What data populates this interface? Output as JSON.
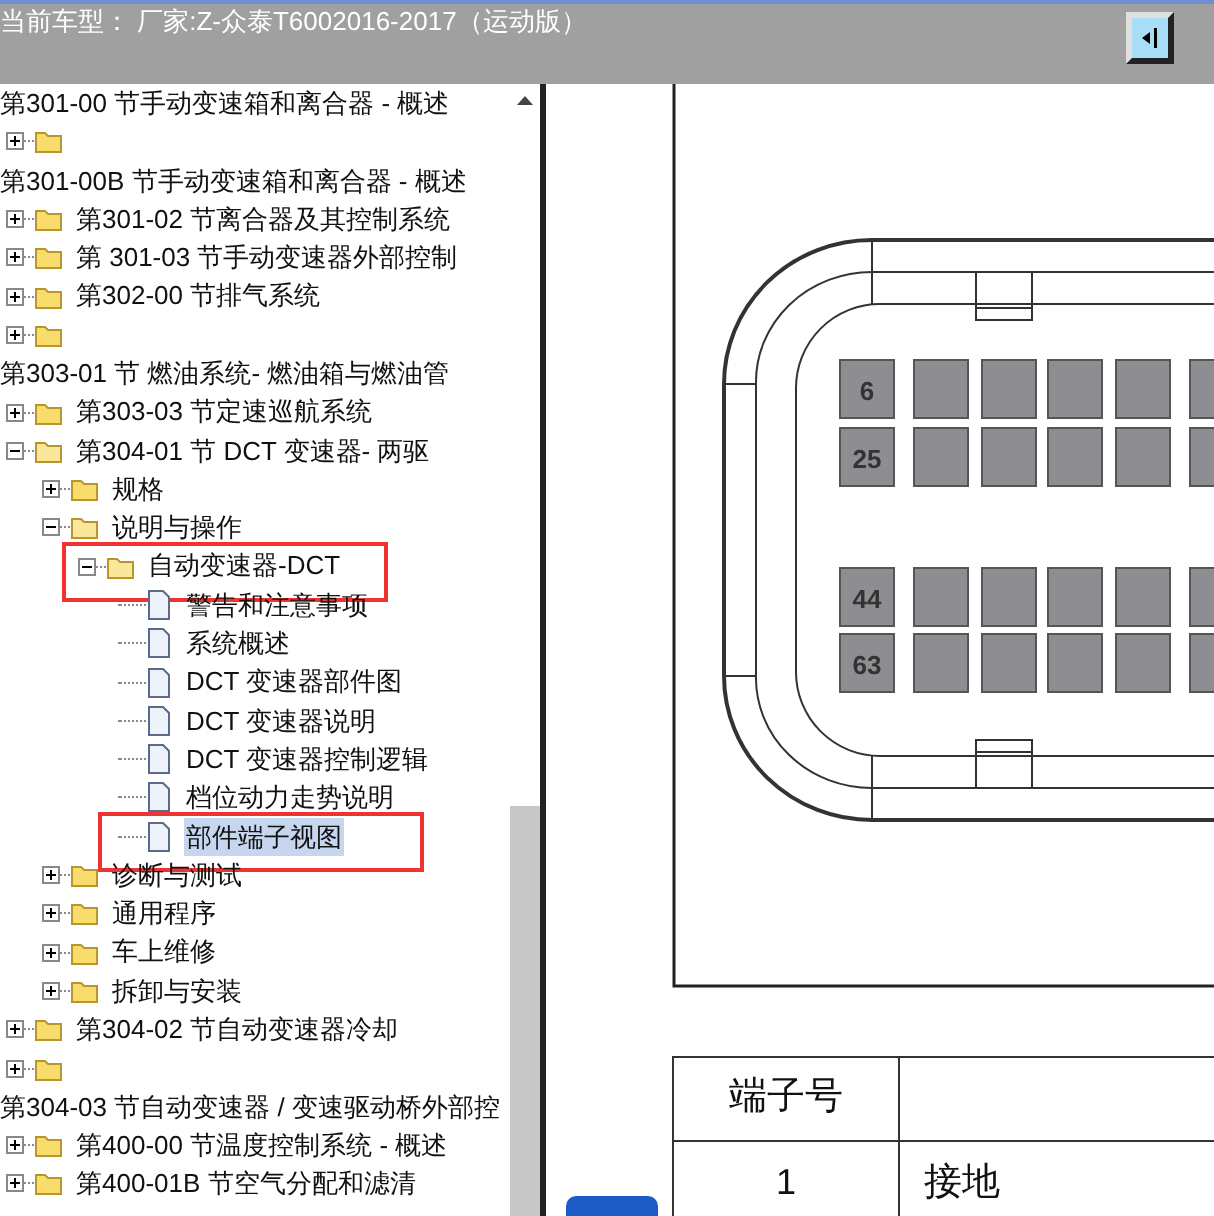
{
  "header": {
    "title": "当前车型： 厂家:Z-众泰T6002016-2017（运动版）"
  },
  "tree": [
    {
      "kind": "heading",
      "label": "第301-00 节手动变速箱和离合器 - 概述"
    },
    {
      "kind": "folder",
      "expanded": false
    },
    {
      "kind": "heading",
      "label": "第301-00B 节手动变速箱和离合器 - 概述"
    },
    {
      "kind": "folder",
      "label": "第301-02 节离合器及其控制系统",
      "expanded": false
    },
    {
      "kind": "folder",
      "label": "第 301-03 节手动变速器外部控制",
      "expanded": false
    },
    {
      "kind": "folder",
      "label": "第302-00 节排气系统",
      "expanded": false
    },
    {
      "kind": "folder",
      "expanded": false
    },
    {
      "kind": "heading",
      "label": "第303-01 节 燃油系统- 燃油箱与燃油管"
    },
    {
      "kind": "folder",
      "label": "第303-03 节定速巡航系统",
      "expanded": false
    },
    {
      "kind": "folder",
      "label": "第304-01 节 DCT 变速器- 两驱",
      "expanded": true,
      "children": [
        {
          "kind": "folder",
          "label": "规格",
          "expanded": false
        },
        {
          "kind": "folder",
          "label": "说明与操作",
          "expanded": true,
          "children": [
            {
              "kind": "folder",
              "label": "自动变速器-DCT",
              "expanded": true,
              "marked": true,
              "children": [
                {
                  "kind": "document",
                  "label": "警告和注意事项",
                  "selected": false
                },
                {
                  "kind": "document",
                  "label": "系统概述",
                  "selected": false
                },
                {
                  "kind": "document",
                  "label": "DCT 变速器部件图",
                  "selected": false
                },
                {
                  "kind": "document",
                  "label": "DCT 变速器说明",
                  "selected": false
                },
                {
                  "kind": "document",
                  "label": "DCT 变速器控制逻辑",
                  "selected": false
                },
                {
                  "kind": "document",
                  "label": "档位动力走势说明",
                  "selected": false
                },
                {
                  "kind": "document",
                  "label": "部件端子视图",
                  "selected": true,
                  "marked": true
                }
              ]
            }
          ]
        },
        {
          "kind": "folder",
          "label": "诊断与测试",
          "expanded": false
        },
        {
          "kind": "folder",
          "label": "通用程序",
          "expanded": false
        },
        {
          "kind": "folder",
          "label": "车上维修",
          "expanded": false
        },
        {
          "kind": "folder",
          "label": "拆卸与安装",
          "expanded": false
        }
      ]
    },
    {
      "kind": "folder",
      "label": "第304-02 节自动变速器冷却",
      "expanded": false
    },
    {
      "kind": "folder",
      "expanded": false
    },
    {
      "kind": "heading",
      "label": "第304-03 节自动变速器 / 变速驱动桥外部控"
    },
    {
      "kind": "folder",
      "label": "第400-00 节温度控制系统 - 概述",
      "expanded": false
    },
    {
      "kind": "folder",
      "label": "第400-01B 节空气分配和滤清",
      "expanded": false
    }
  ],
  "connector": {
    "row_labels": [
      "6",
      "25",
      "44",
      "63"
    ]
  },
  "pin_table": {
    "columns": [
      "端子号"
    ],
    "rows": [
      {
        "cells": [
          "1",
          "接地"
        ]
      }
    ]
  }
}
